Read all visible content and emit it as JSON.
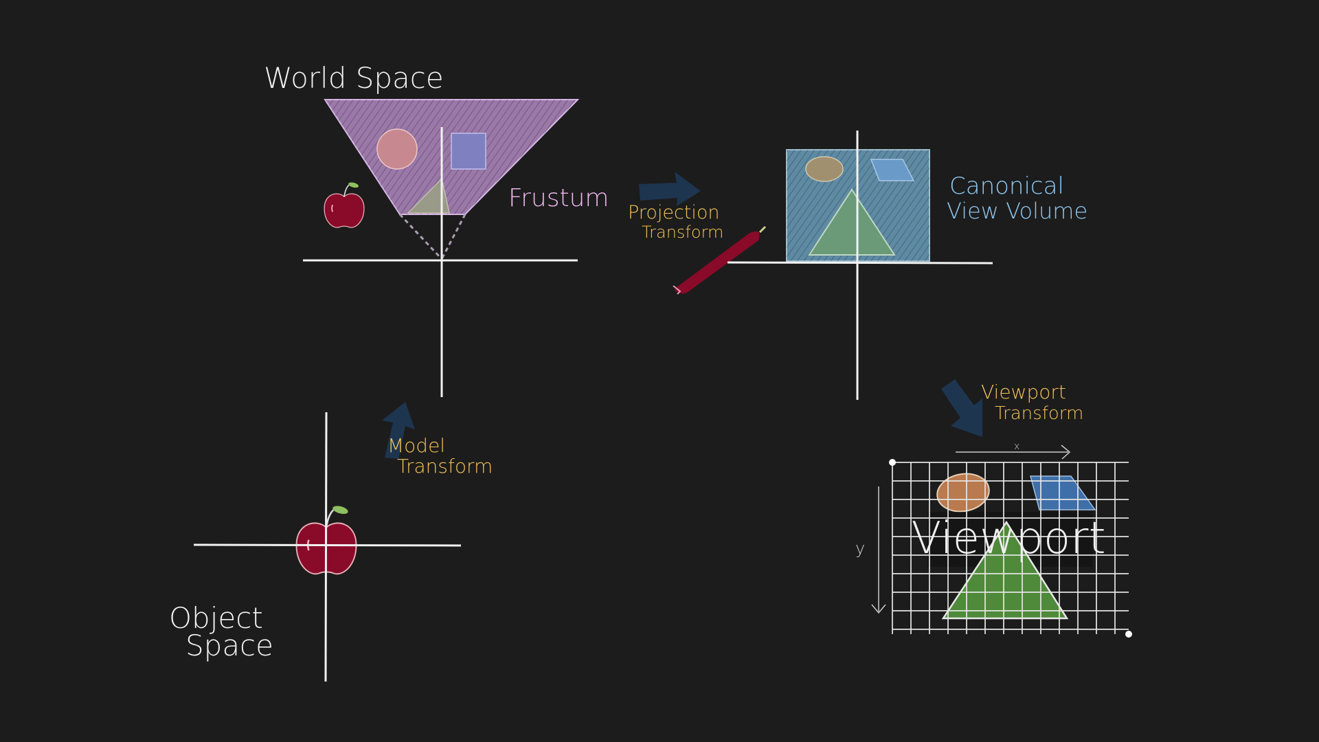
{
  "colors": {
    "background": "#1c1c1c",
    "chalk_white": "#f2f2f2",
    "frustum": "#9a78a8",
    "frustum_label": "#f0b8f0",
    "transform_label": "#f2c25a",
    "arrow": "#1e3550",
    "canonical": "#5e8aa3",
    "canonical_label": "#8fc8f0",
    "apple": "#8a0a2a",
    "ellipse": "#c8865a",
    "parallelogram": "#3f6fa8",
    "triangle": "#4e8a3a"
  },
  "labels": {
    "world_space": "World Space",
    "frustum": "Frustum",
    "projection_line1": "Projection",
    "projection_line2": "Transform",
    "canonical_line1": "Canonical",
    "canonical_line2": "View Volume",
    "model_line1": "Model",
    "model_line2": "Transform",
    "object_line1": "Object",
    "object_line2": "Space",
    "viewport_transform_line1": "Viewport",
    "viewport_transform_line2": "Transform",
    "viewport": "Viewport",
    "x_axis": "x",
    "y_axis": "y"
  },
  "icons": [
    "apple-icon",
    "chalk-stick-icon",
    "arrow-icon"
  ]
}
